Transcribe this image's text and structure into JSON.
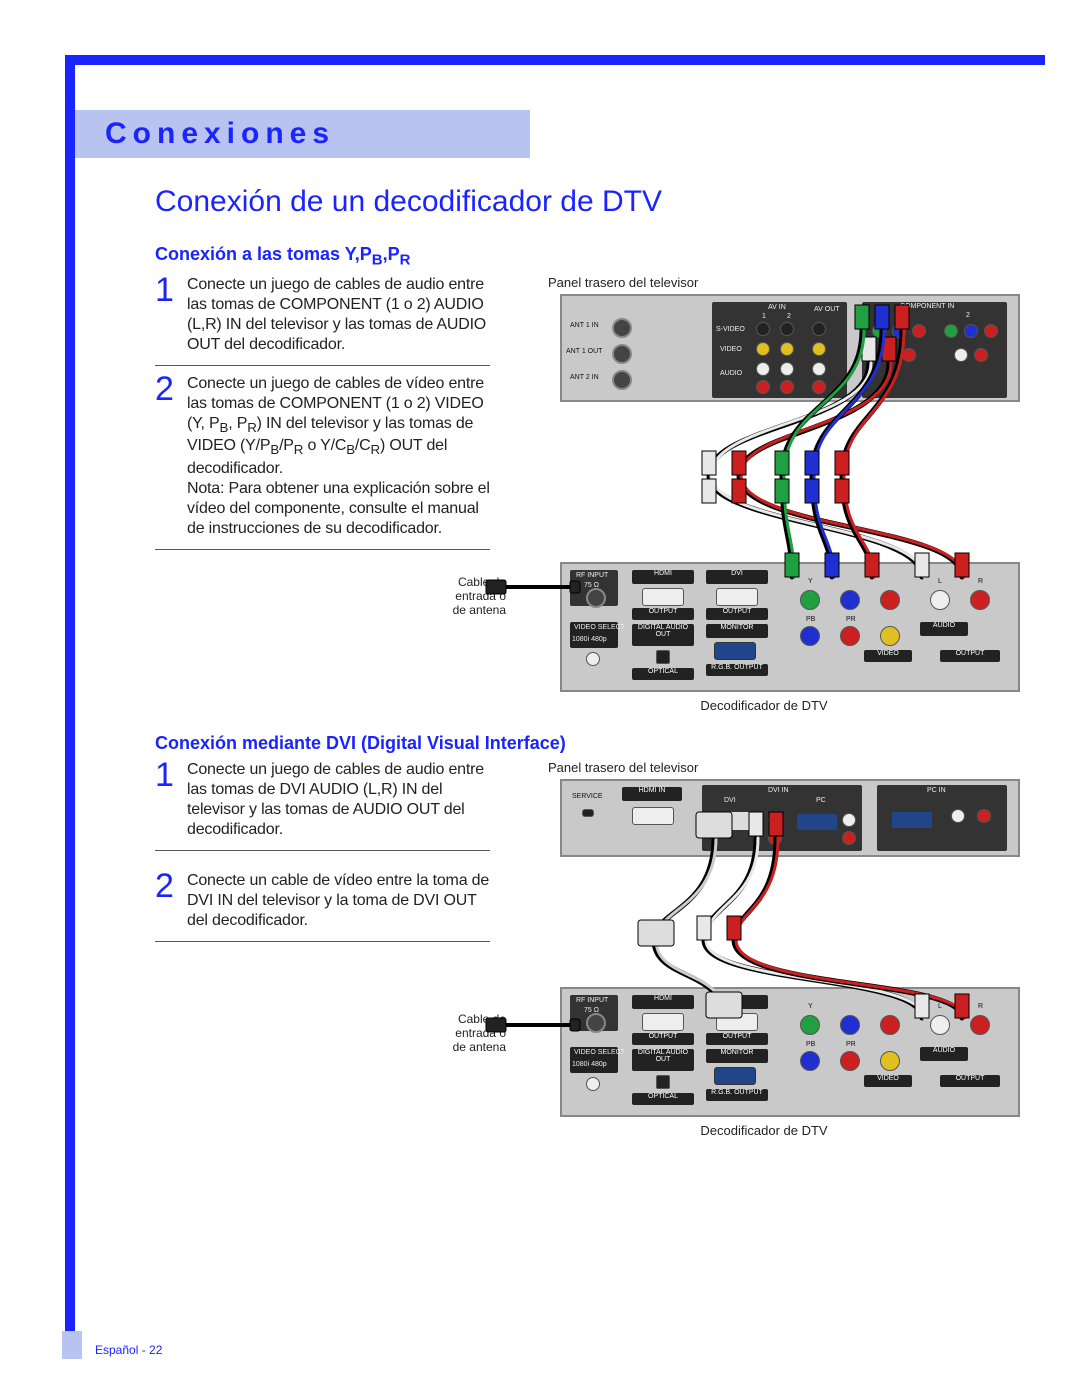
{
  "chapter": "Conexiones",
  "main_title": "Conexión de un decodificador de DTV",
  "sectionA": {
    "subtitle_pre": "Conexión a las tomas Y,P",
    "subtitle_b": "B",
    "subtitle_mid": ",P",
    "subtitle_r": "R",
    "step1": "Conecte un juego de cables de audio entre las tomas de COMPONENT (1 o 2) AUDIO (L,R) IN del televisor y las tomas de AUDIO OUT del decodificador.",
    "step2_a": "Conecte un juego de cables de vídeo entre las tomas de COMPONENT (1 o 2) VIDEO (Y, P",
    "step2_b": "B",
    "step2_c": ", P",
    "step2_d": "R",
    "step2_e": ") IN del televisor y las tomas de VIDEO (Y/P",
    "step2_f": "B",
    "step2_g": "/P",
    "step2_h": "R",
    "step2_i": " o Y/C",
    "step2_j": "B",
    "step2_k": "/C",
    "step2_l": "R",
    "step2_m": ") OUT del decodificador.",
    "step2_note": "Nota: Para obtener una explicación sobre el vídeo del componente, consulte el manual de instrucciones de su decodificador.",
    "fig_top": "Panel trasero del televisor",
    "fig_side": "Cable de entrada o de antena",
    "fig_bottom": "Decodificador de DTV"
  },
  "sectionB": {
    "subtitle": "Conexión mediante DVI (Digital Visual Interface)",
    "step1": "Conecte un juego de cables de audio entre las tomas de DVI AUDIO (L,R) IN del televisor y las tomas de AUDIO OUT del decodificador.",
    "step2": "Conecte un cable de vídeo entre la toma de DVI IN del televisor y la toma de DVI OUT del decodificador.",
    "fig_top": "Panel trasero del televisor",
    "fig_side": "Cable de entrada o de antena",
    "fig_bottom": "Decodificador de DTV"
  },
  "labels": {
    "ant1_in": "ANT 1 IN",
    "ant1_out": "ANT 1 OUT",
    "ant2_in": "ANT 2 IN",
    "svideo": "S-VIDEO",
    "video": "VIDEO",
    "audio": "AUDIO",
    "av_in": "AV IN",
    "av_out": "AV OUT",
    "component_in": "COMPONENT IN",
    "one": "1",
    "two": "2",
    "rf_input": "RF INPUT",
    "ohm": "75 Ω",
    "hdmi": "HDMI",
    "dvi": "DVI",
    "output": "OUTPUT",
    "video_select": "VIDEO SELECT",
    "res": "1080i  480p",
    "digital_audio_out": "DIGITAL AUDIO OUT",
    "optical": "OPTICAL",
    "monitor": "MONITOR",
    "rgb_output": "R.G.B. OUTPUT",
    "y": "Y",
    "pb": "PB",
    "pr": "PR",
    "l": "L",
    "r": "R",
    "dvi_in": "DVI IN",
    "pc_in": "PC IN",
    "pc": "PC",
    "hdmi_in": "HDMI IN",
    "service": "SERVICE"
  },
  "footer": "Español - 22"
}
